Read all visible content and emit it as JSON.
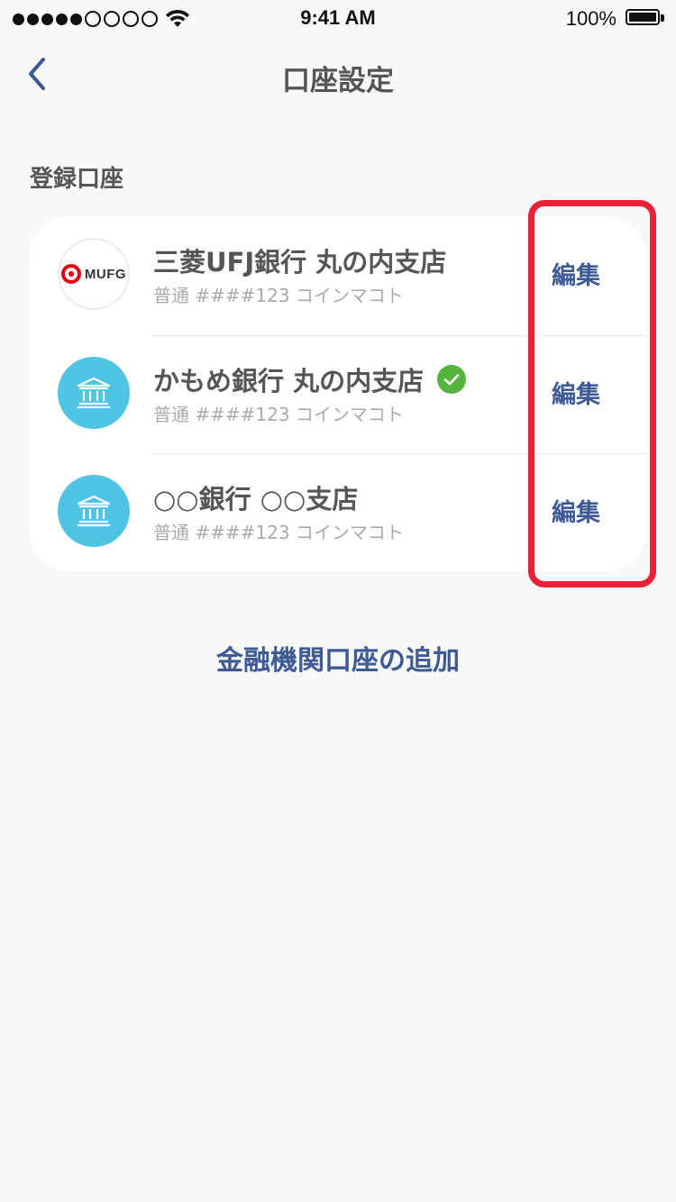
{
  "status_bar": {
    "time": "9:41 AM",
    "battery": "100%",
    "signal_filled": 5,
    "signal_empty": 4
  },
  "nav": {
    "title": "口座設定",
    "back_icon": "chevron-left-icon"
  },
  "section": {
    "label": "登録口座"
  },
  "accounts": [
    {
      "bank_name": "三菱UFJ銀行 丸の内支店",
      "detail": "普通 ####123 コインマコト",
      "edit_label": "編集",
      "logo": "MUFG",
      "verified": false
    },
    {
      "bank_name": "かもめ銀行 丸の内支店",
      "detail": "普通 ####123 コインマコト",
      "edit_label": "編集",
      "icon": "bank-icon",
      "verified": true
    },
    {
      "bank_name": "○○銀行 ○○支店",
      "detail": "普通 ####123 コインマコト",
      "edit_label": "編集",
      "icon": "bank-icon",
      "verified": false
    }
  ],
  "add_account_label": "金融機関口座の追加",
  "colors": {
    "accent": "#3d5a94",
    "bank_icon_bg": "#4ec4e2",
    "verified": "#55b43c",
    "highlight": "#ea2038",
    "mufg_red": "#e60012"
  }
}
